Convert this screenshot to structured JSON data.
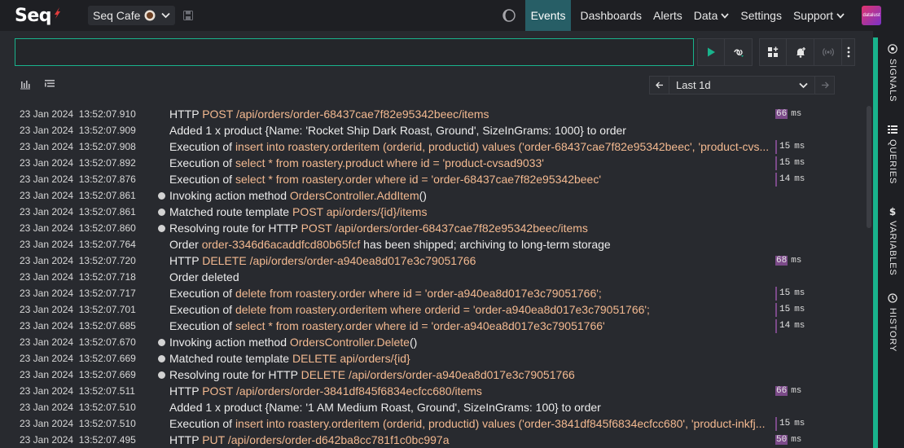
{
  "app": {
    "logo": "Seq"
  },
  "workspace": {
    "name": "Seq Cafe"
  },
  "nav": [
    {
      "label": "Events",
      "active": true,
      "has_menu": false
    },
    {
      "label": "Dashboards",
      "active": false,
      "has_menu": false
    },
    {
      "label": "Alerts",
      "active": false,
      "has_menu": false
    },
    {
      "label": "Data",
      "active": false,
      "has_menu": true
    },
    {
      "label": "Settings",
      "active": false,
      "has_menu": false
    },
    {
      "label": "Support",
      "active": false,
      "has_menu": true
    }
  ],
  "avatar": {
    "text": "datalust"
  },
  "sidebar": [
    {
      "label": "SIGNALS",
      "icon": "signals-icon"
    },
    {
      "label": "QUERIES",
      "icon": "queries-icon"
    },
    {
      "label": "VARIABLES",
      "icon": "variables-icon"
    },
    {
      "label": "HISTORY",
      "icon": "history-icon"
    }
  ],
  "search": {
    "value": "",
    "placeholder": ""
  },
  "range": {
    "label": "Last 1d"
  },
  "colors": {
    "accent": "#19b38c",
    "active_nav": "#275e66",
    "property": "#f3b990",
    "duration": "#7b4a89"
  },
  "events": [
    {
      "ts": "23 Jan 2024  13:52:07.910",
      "level": false,
      "msg": [
        [
          "t",
          "HTTP "
        ],
        [
          "p",
          "POST"
        ],
        [
          "t",
          " "
        ],
        [
          "p",
          "/api/orders/order-68437cae7f82e95342beec/items"
        ]
      ],
      "dur": "66",
      "hi": true
    },
    {
      "ts": "23 Jan 2024  13:52:07.909",
      "level": false,
      "msg": [
        [
          "t",
          "Added 1 x product {Name: 'Rocket Ship Dark Roast, Ground', SizeInGrams: 1000} to order"
        ]
      ],
      "dur": "",
      "hi": false
    },
    {
      "ts": "23 Jan 2024  13:52:07.908",
      "level": false,
      "msg": [
        [
          "t",
          "Execution of "
        ],
        [
          "p",
          "insert into roastery.orderitem (orderid, productid) values ('order-68437cae7f82e95342beec', 'product-cvs..."
        ]
      ],
      "dur": "15",
      "hi": false
    },
    {
      "ts": "23 Jan 2024  13:52:07.892",
      "level": false,
      "msg": [
        [
          "t",
          "Execution of "
        ],
        [
          "p",
          "select * from roastery.product where id = 'product-cvsad9033'"
        ]
      ],
      "dur": "15",
      "hi": false
    },
    {
      "ts": "23 Jan 2024  13:52:07.876",
      "level": false,
      "msg": [
        [
          "t",
          "Execution of "
        ],
        [
          "p",
          "select * from roastery.order where id = 'order-68437cae7f82e95342beec'"
        ]
      ],
      "dur": "14",
      "hi": false
    },
    {
      "ts": "23 Jan 2024  13:52:07.861",
      "level": true,
      "msg": [
        [
          "t",
          "Invoking action method "
        ],
        [
          "p",
          "OrdersController.AddItem"
        ],
        [
          "t",
          "()"
        ]
      ],
      "dur": "",
      "hi": false
    },
    {
      "ts": "23 Jan 2024  13:52:07.861",
      "level": true,
      "msg": [
        [
          "t",
          "Matched route template "
        ],
        [
          "p",
          "POST api/orders/{id}/items"
        ]
      ],
      "dur": "",
      "hi": false
    },
    {
      "ts": "23 Jan 2024  13:52:07.860",
      "level": true,
      "msg": [
        [
          "t",
          "Resolving route for HTTP "
        ],
        [
          "p",
          "POST"
        ],
        [
          "t",
          " "
        ],
        [
          "p",
          "/api/orders/order-68437cae7f82e95342beec/items"
        ]
      ],
      "dur": "",
      "hi": false
    },
    {
      "ts": "23 Jan 2024  13:52:07.764",
      "level": false,
      "msg": [
        [
          "t",
          "Order "
        ],
        [
          "p",
          "order-3346d6acaddfcd80b65fcf"
        ],
        [
          "t",
          " has been shipped; archiving to long-term storage"
        ]
      ],
      "dur": "",
      "hi": false
    },
    {
      "ts": "23 Jan 2024  13:52:07.720",
      "level": false,
      "msg": [
        [
          "t",
          "HTTP "
        ],
        [
          "p",
          "DELETE"
        ],
        [
          "t",
          " "
        ],
        [
          "p",
          "/api/orders/order-a940ea8d017e3c79051766"
        ]
      ],
      "dur": "68",
      "hi": true
    },
    {
      "ts": "23 Jan 2024  13:52:07.718",
      "level": false,
      "msg": [
        [
          "t",
          "Order deleted"
        ]
      ],
      "dur": "",
      "hi": false
    },
    {
      "ts": "23 Jan 2024  13:52:07.717",
      "level": false,
      "msg": [
        [
          "t",
          "Execution of "
        ],
        [
          "p",
          "delete from roastery.order where id = 'order-a940ea8d017e3c79051766';"
        ]
      ],
      "dur": "15",
      "hi": false
    },
    {
      "ts": "23 Jan 2024  13:52:07.701",
      "level": false,
      "msg": [
        [
          "t",
          "Execution of "
        ],
        [
          "p",
          "delete from roastery.orderitem where orderid = 'order-a940ea8d017e3c79051766';"
        ]
      ],
      "dur": "15",
      "hi": false
    },
    {
      "ts": "23 Jan 2024  13:52:07.685",
      "level": false,
      "msg": [
        [
          "t",
          "Execution of "
        ],
        [
          "p",
          "select * from roastery.order where id = 'order-a940ea8d017e3c79051766'"
        ]
      ],
      "dur": "14",
      "hi": false
    },
    {
      "ts": "23 Jan 2024  13:52:07.670",
      "level": true,
      "msg": [
        [
          "t",
          "Invoking action method "
        ],
        [
          "p",
          "OrdersController.Delete"
        ],
        [
          "t",
          "()"
        ]
      ],
      "dur": "",
      "hi": false
    },
    {
      "ts": "23 Jan 2024  13:52:07.669",
      "level": true,
      "msg": [
        [
          "t",
          "Matched route template "
        ],
        [
          "p",
          "DELETE api/orders/{id}"
        ]
      ],
      "dur": "",
      "hi": false
    },
    {
      "ts": "23 Jan 2024  13:52:07.669",
      "level": true,
      "msg": [
        [
          "t",
          "Resolving route for HTTP "
        ],
        [
          "p",
          "DELETE"
        ],
        [
          "t",
          " "
        ],
        [
          "p",
          "/api/orders/order-a940ea8d017e3c79051766"
        ]
      ],
      "dur": "",
      "hi": false
    },
    {
      "ts": "23 Jan 2024  13:52:07.511",
      "level": false,
      "msg": [
        [
          "t",
          "HTTP "
        ],
        [
          "p",
          "POST"
        ],
        [
          "t",
          " "
        ],
        [
          "p",
          "/api/orders/order-3841df845f6834ecfcc680/items"
        ]
      ],
      "dur": "66",
      "hi": true
    },
    {
      "ts": "23 Jan 2024  13:52:07.510",
      "level": false,
      "msg": [
        [
          "t",
          "Added 1 x product {Name: '1 AM Medium Roast, Ground', SizeInGrams: 100} to order"
        ]
      ],
      "dur": "",
      "hi": false
    },
    {
      "ts": "23 Jan 2024  13:52:07.510",
      "level": false,
      "msg": [
        [
          "t",
          "Execution of "
        ],
        [
          "p",
          "insert into roastery.orderitem (orderid, productid) values ('order-3841df845f6834ecfcc680', 'product-inkfj..."
        ]
      ],
      "dur": "15",
      "hi": false
    },
    {
      "ts": "23 Jan 2024  13:52:07.495",
      "level": false,
      "msg": [
        [
          "t",
          "HTTP "
        ],
        [
          "p",
          "PUT"
        ],
        [
          "t",
          " "
        ],
        [
          "p",
          "/api/orders/order-d642ba8cc781f1c0bc997a"
        ]
      ],
      "dur": "50",
      "hi": true
    }
  ],
  "duration_unit": "ms"
}
